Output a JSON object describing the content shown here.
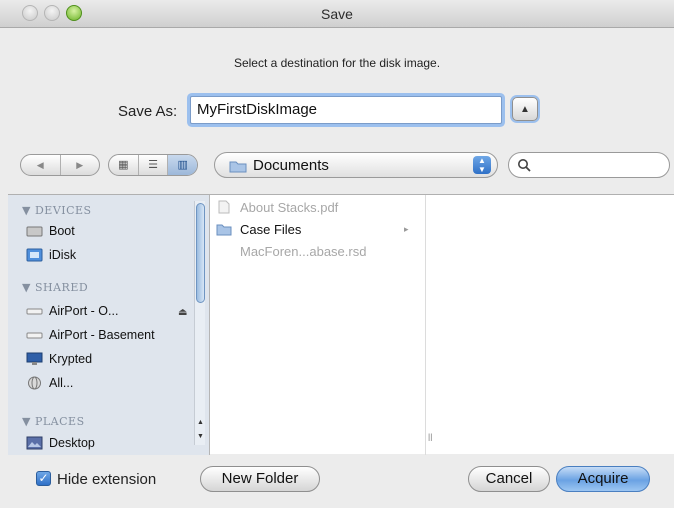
{
  "window": {
    "title": "Save"
  },
  "dialog": {
    "prompt": "Select a destination for the disk image.",
    "save_as_label": "Save As:",
    "save_as_value": "MyFirstDiskImage",
    "location_label": "Documents",
    "search_value": ""
  },
  "sidebar": {
    "devices_header": "DEVICES",
    "devices": [
      {
        "label": "Boot",
        "icon": "drive-icon"
      },
      {
        "label": "iDisk",
        "icon": "idisk-icon"
      }
    ],
    "shared_header": "SHARED",
    "shared": [
      {
        "label": "AirPort - O...",
        "icon": "airport-icon"
      },
      {
        "label": "AirPort - Basement",
        "icon": "airport-icon"
      },
      {
        "label": "Krypted",
        "icon": "computer-icon"
      },
      {
        "label": "All...",
        "icon": "network-icon"
      }
    ],
    "places_header": "PLACES",
    "places": [
      {
        "label": "Desktop",
        "icon": "desktop-icon"
      }
    ]
  },
  "files": [
    {
      "label": "About Stacks.pdf",
      "type": "file",
      "enabled": false
    },
    {
      "label": "Case Files",
      "type": "folder",
      "enabled": true
    },
    {
      "label": "MacForen...abase.rsd",
      "type": "file",
      "enabled": false
    }
  ],
  "footer": {
    "hide_extension_label": "Hide extension",
    "hide_extension_checked": true,
    "new_folder_label": "New Folder",
    "cancel_label": "Cancel",
    "acquire_label": "Acquire"
  },
  "colors": {
    "accent": "#3f7fd6",
    "selection_glow": "#9cc0ee",
    "sidebar_bg": "#dfe5ed"
  }
}
